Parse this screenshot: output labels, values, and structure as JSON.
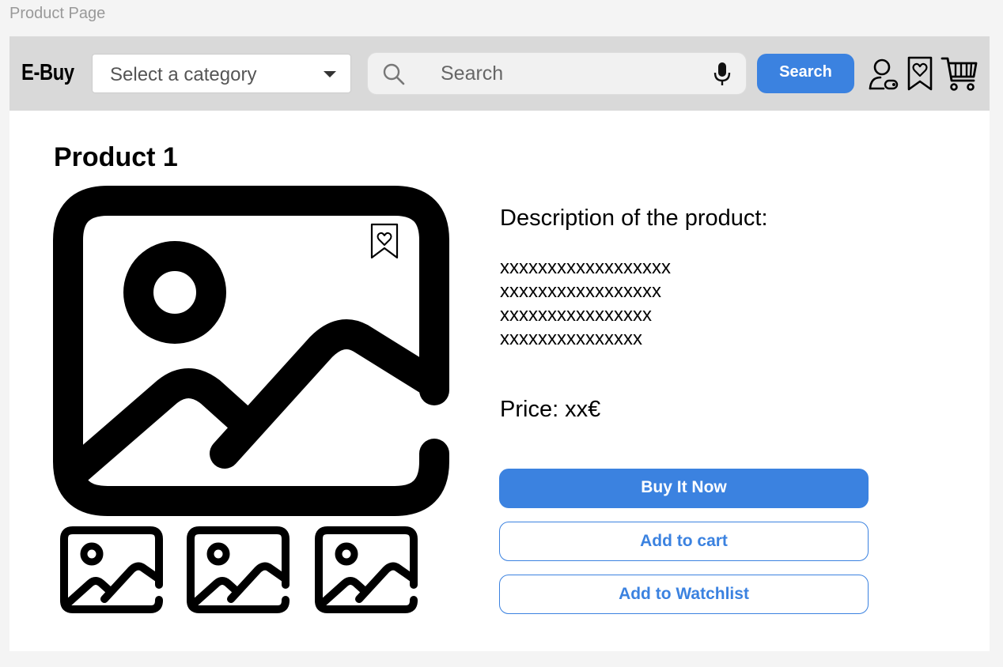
{
  "page_label": "Product Page",
  "header": {
    "logo": "E-Buy",
    "category_select": {
      "value": "Select a category"
    },
    "search": {
      "placeholder": "Search",
      "button_label": "Search"
    },
    "icons": [
      "search-icon",
      "microphone-icon",
      "user-icon",
      "watchlist-icon",
      "cart-icon"
    ]
  },
  "product": {
    "title": "Product 1",
    "description_label": "Description of the product:",
    "description_lines": [
      "xxxxxxxxxxxxxxxxxx",
      "xxxxxxxxxxxxxxxxx",
      "xxxxxxxxxxxxxxxx",
      "xxxxxxxxxxxxxxx"
    ],
    "price": "Price: xx€",
    "thumbnail_count": 3
  },
  "actions": {
    "buy_now": "Buy It Now",
    "add_to_cart": "Add to cart",
    "add_to_watchlist": "Add to Watchlist"
  },
  "colors": {
    "accent": "#3b82e0",
    "header_bg": "#d9d9d9",
    "page_bg": "#f4f4f4"
  }
}
